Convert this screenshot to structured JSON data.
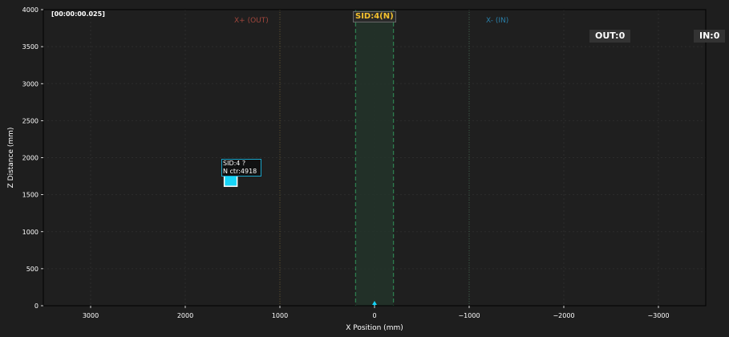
{
  "timestamp": "[00:00:00.025]",
  "sid_title": "SID:4(N)",
  "zones": {
    "out_label": "X+ (OUT)",
    "in_label": "X- (IN)"
  },
  "counters": {
    "out": "OUT:0",
    "in": "IN:0"
  },
  "object": {
    "label_line1": "SID:4 ?",
    "label_line2": "N ctr:4918",
    "color": "#17d4f7"
  },
  "colors": {
    "background": "#1e1e1e",
    "plot_bg": "#1f1f1f",
    "zone_green": "#2e7d4f",
    "out_color": "#a0463c",
    "in_color": "#2a7fa8",
    "sensor_marker": "#17d4f7"
  },
  "chart_data": {
    "type": "scatter",
    "xlabel": "X Position (mm)",
    "ylabel": "Z Distance (mm)",
    "xlim": [
      3500,
      -3500
    ],
    "ylim": [
      0,
      4000
    ],
    "x_inverted": true,
    "x_ticks": [
      3000,
      2000,
      1000,
      0,
      -1000,
      -2000,
      -3000
    ],
    "x_tick_labels": [
      "3000",
      "2000",
      "1000",
      "0",
      "−1000",
      "−2000",
      "−3000"
    ],
    "y_ticks": [
      0,
      500,
      1000,
      1500,
      2000,
      2500,
      3000,
      3500,
      4000
    ],
    "y_tick_labels": [
      "0",
      "500",
      "1000",
      "1500",
      "2000",
      "2500",
      "3000",
      "3500",
      "4000"
    ],
    "grid": true,
    "detection_band": [
      -200,
      200
    ],
    "boundary_lines": [
      1000,
      -1000
    ],
    "sensor_position": [
      0,
      0
    ],
    "points": [
      {
        "x": 1520,
        "y": 1700
      }
    ]
  }
}
